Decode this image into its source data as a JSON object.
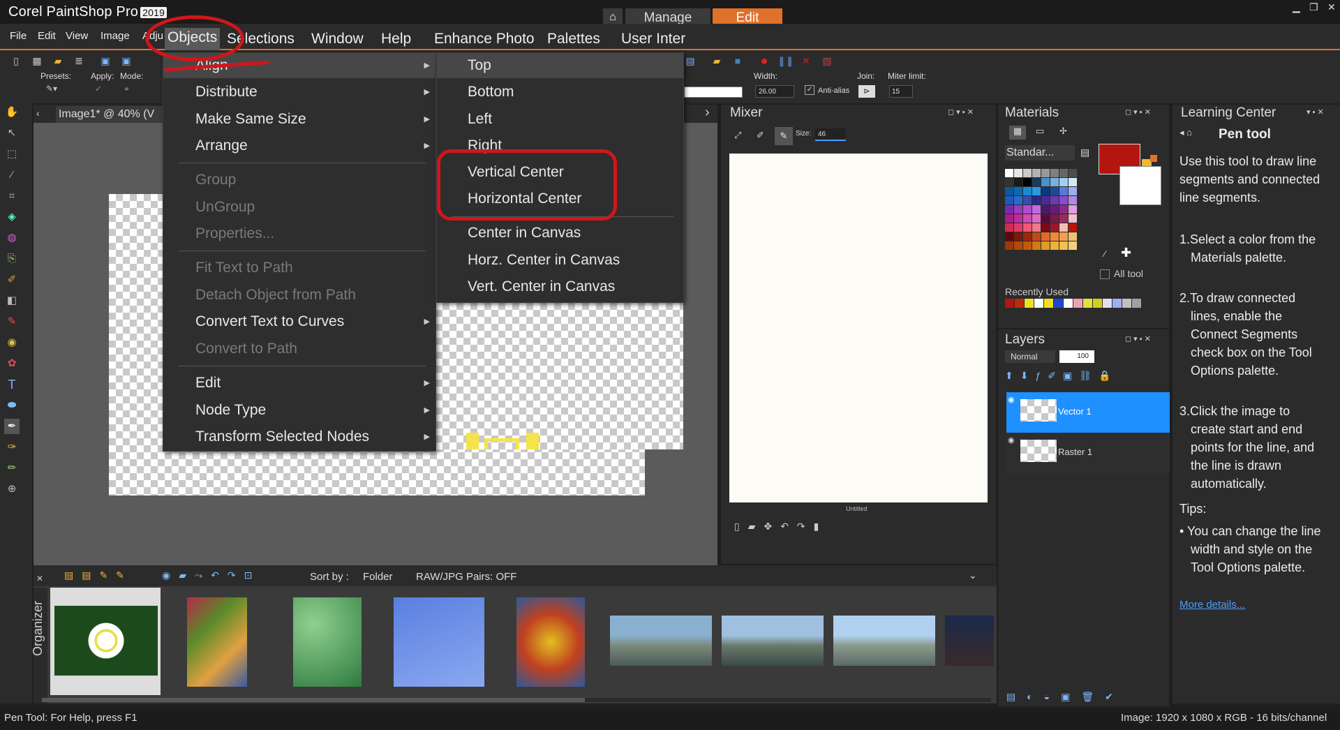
{
  "app": {
    "title": "Corel PaintShop Pro",
    "year": "2019"
  },
  "nav": {
    "home_icon": "home-icon",
    "manage": "Manage",
    "edit": "Edit"
  },
  "menubar": {
    "file": "File",
    "edit": "Edit",
    "view": "View",
    "image": "Image",
    "adjust": "Adju",
    "objects": "Objects",
    "selections": "Selections",
    "window": "Window",
    "help": "Help",
    "enhance": "Enhance Photo",
    "palettes": "Palettes",
    "user": "User Inter"
  },
  "tool_options": {
    "presets": "Presets:",
    "apply": "Apply:",
    "mode": "Mode:",
    "width_label": "Width:",
    "width_value": "26.00",
    "antialias": "Anti-alias",
    "join_label": "Join:",
    "miter_label": "Miter limit:",
    "miter_value": "15"
  },
  "document": {
    "tab": "Image1* @  40% (V"
  },
  "objects_menu": [
    {
      "label": "Align",
      "submenu": true,
      "enabled": true,
      "highlighted": true
    },
    {
      "label": "Distribute",
      "submenu": true,
      "enabled": true
    },
    {
      "label": "Make Same Size",
      "submenu": true,
      "enabled": true
    },
    {
      "label": "Arrange",
      "submenu": true,
      "enabled": true
    },
    {
      "label": "Group",
      "enabled": false
    },
    {
      "label": "UnGroup",
      "enabled": false
    },
    {
      "label": "Properties...",
      "enabled": false
    },
    {
      "label": "Fit Text to Path",
      "enabled": false
    },
    {
      "label": "Detach Object from Path",
      "enabled": false
    },
    {
      "label": "Convert Text to Curves",
      "submenu": true,
      "enabled": true
    },
    {
      "label": "Convert to Path",
      "enabled": false
    },
    {
      "label": "Edit",
      "submenu": true,
      "enabled": true
    },
    {
      "label": "Node Type",
      "submenu": true,
      "enabled": true
    },
    {
      "label": "Transform Selected Nodes",
      "submenu": true,
      "enabled": true
    }
  ],
  "align_submenu": [
    {
      "label": "Top",
      "highlighted": true
    },
    {
      "label": "Bottom"
    },
    {
      "label": "Left"
    },
    {
      "label": "Right"
    },
    {
      "label": "Vertical Center"
    },
    {
      "label": "Horizontal Center"
    },
    {
      "label": "Center in Canvas"
    },
    {
      "label": "Horz. Center in Canvas"
    },
    {
      "label": "Vert. Center in Canvas"
    }
  ],
  "mixer": {
    "title": "Mixer",
    "size_label": "Size:",
    "size_value": "46",
    "caption": "Untitled"
  },
  "materials": {
    "title": "Materials",
    "library": "Standar...",
    "all_tools": "All tool",
    "recently_used": "Recently Used",
    "foreground_color": "#b5150f",
    "background_color": "#ffffff"
  },
  "layers": {
    "title": "Layers",
    "blend_mode": "Normal",
    "opacity": "100",
    "items": [
      {
        "name": "Vector 1",
        "selected": true
      },
      {
        "name": "Raster 1",
        "selected": false
      }
    ]
  },
  "learning_center": {
    "title": "Learning Center",
    "tool_name": "Pen tool",
    "intro": "Use this tool to draw line segments and connected line segments.",
    "steps": [
      "Select a color from the Materials palette.",
      "To draw connected lines, enable the Connect Segments check box on the Tool Options palette.",
      "Click the image to create start and end points for the line, and the line is drawn automatically."
    ],
    "tips_label": "Tips:",
    "tip": "You can change the line width and style on the Tool Options palette.",
    "more_link": "More details..."
  },
  "organizer": {
    "label": "Organizer",
    "sort_by": "Sort by :",
    "folder": "Folder",
    "raw_pairs": "RAW/JPG Pairs: OFF"
  },
  "status": {
    "left": "Pen Tool: For Help, press F1",
    "right": "Image:  1920 x 1080 x RGB - 16 bits/channel"
  },
  "colors": {
    "accent": "#e0712b",
    "annotation": "#d0161b",
    "selection": "#1e90ff"
  }
}
